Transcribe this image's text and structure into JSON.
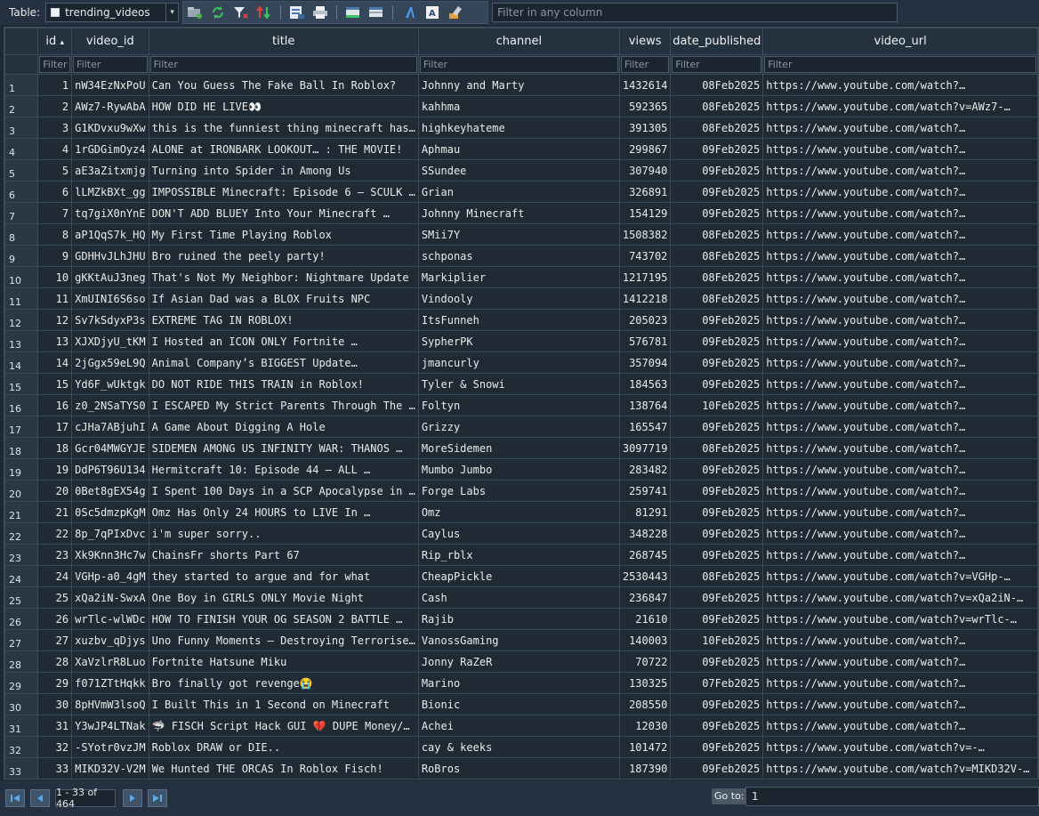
{
  "toolbar": {
    "table_label": "Table:",
    "table_name": "trending_videos",
    "filter_all_placeholder": "Filter in any column",
    "icons": [
      "open-tab-icon",
      "refresh-icon",
      "clear-filters-icon",
      "sort-icon",
      "save-table-icon",
      "print-icon",
      "add-record-icon",
      "delete-record-icon",
      "font-icon",
      "text-icon",
      "highlight-icon"
    ]
  },
  "columns": [
    {
      "key": "id",
      "label": "id",
      "sort": "▴"
    },
    {
      "key": "video_id",
      "label": "video_id"
    },
    {
      "key": "title",
      "label": "title"
    },
    {
      "key": "channel",
      "label": "channel"
    },
    {
      "key": "views",
      "label": "views"
    },
    {
      "key": "date_published",
      "label": "date_published"
    },
    {
      "key": "video_url",
      "label": "video_url"
    }
  ],
  "filter_placeholder": "Filter",
  "rows": [
    {
      "n": "1",
      "id": "1",
      "video_id": "nW34EzNxPoU",
      "title": "Can You Guess The Fake Ball In Roblox?",
      "channel": "Johnny and Marty",
      "views": "1432614",
      "date": "08Feb2025",
      "url": "https://www.youtube.com/watch?…"
    },
    {
      "n": "2",
      "id": "2",
      "video_id": "AWz7-RywAbA",
      "title": "HOW DID HE LIVE👀",
      "channel": "kahhma",
      "views": "592365",
      "date": "08Feb2025",
      "url": "https://www.youtube.com/watch?v=AWz7-…"
    },
    {
      "n": "3",
      "id": "3",
      "video_id": "G1KDvxu9wXw",
      "title": "this is the funniest thing minecraft has…",
      "channel": "highkeyhateme",
      "views": "391305",
      "date": "08Feb2025",
      "url": "https://www.youtube.com/watch?…"
    },
    {
      "n": "4",
      "id": "4",
      "video_id": "1rGDGimOyz4",
      "title": "ALONE at IRONBARK LOOKOUT… : THE MOVIE!",
      "channel": "Aphmau",
      "views": "299867",
      "date": "09Feb2025",
      "url": "https://www.youtube.com/watch?…"
    },
    {
      "n": "5",
      "id": "5",
      "video_id": "aE3aZitxmjg",
      "title": "Turning into Spider in Among Us",
      "channel": "SSundee",
      "views": "307940",
      "date": "09Feb2025",
      "url": "https://www.youtube.com/watch?…"
    },
    {
      "n": "6",
      "id": "6",
      "video_id": "lLMZkBXt_gg",
      "title": "IMPOSSIBLE Minecraft: Episode 6 – SCULK …",
      "channel": "Grian",
      "views": "326891",
      "date": "09Feb2025",
      "url": "https://www.youtube.com/watch?…"
    },
    {
      "n": "7",
      "id": "7",
      "video_id": "tq7giX0nYnE",
      "title": "DON'T ADD BLUEY Into Your Minecraft …",
      "channel": "Johnny Minecraft",
      "views": "154129",
      "date": "09Feb2025",
      "url": "https://www.youtube.com/watch?…"
    },
    {
      "n": "8",
      "id": "8",
      "video_id": "aP1QqS7k_HQ",
      "title": "My First Time Playing Roblox",
      "channel": "SMii7Y",
      "views": "1508382",
      "date": "08Feb2025",
      "url": "https://www.youtube.com/watch?…"
    },
    {
      "n": "9",
      "id": "9",
      "video_id": "GDHHvJLhJHU",
      "title": "Bro ruined the peely party!",
      "channel": "schponas",
      "views": "743702",
      "date": "08Feb2025",
      "url": "https://www.youtube.com/watch?…"
    },
    {
      "n": "10",
      "id": "10",
      "video_id": "gKKtAuJ3neg",
      "title": "That's Not My Neighbor: Nightmare Update",
      "channel": "Markiplier",
      "views": "1217195",
      "date": "08Feb2025",
      "url": "https://www.youtube.com/watch?…"
    },
    {
      "n": "11",
      "id": "11",
      "video_id": "XmUINI6S6so",
      "title": "If Asian Dad was a BLOX Fruits NPC",
      "channel": "Vindooly",
      "views": "1412218",
      "date": "08Feb2025",
      "url": "https://www.youtube.com/watch?…"
    },
    {
      "n": "12",
      "id": "12",
      "video_id": "Sv7kSdyxP3s",
      "title": "EXTREME TAG IN ROBLOX!",
      "channel": "ItsFunneh",
      "views": "205023",
      "date": "09Feb2025",
      "url": "https://www.youtube.com/watch?…"
    },
    {
      "n": "13",
      "id": "13",
      "video_id": "XJXDjyU_tKM",
      "title": "I Hosted an ICON ONLY Fortnite …",
      "channel": "SypherPK",
      "views": "576781",
      "date": "09Feb2025",
      "url": "https://www.youtube.com/watch?…"
    },
    {
      "n": "14",
      "id": "14",
      "video_id": "2jGgx59eL9Q",
      "title": "Animal Company’s BIGGEST Update…",
      "channel": "jmancurly",
      "views": "357094",
      "date": "09Feb2025",
      "url": "https://www.youtube.com/watch?…"
    },
    {
      "n": "15",
      "id": "15",
      "video_id": "Yd6F_wUktgk",
      "title": "DO NOT RIDE THIS TRAIN in Roblox!",
      "channel": "Tyler & Snowi",
      "views": "184563",
      "date": "09Feb2025",
      "url": "https://www.youtube.com/watch?…"
    },
    {
      "n": "16",
      "id": "16",
      "video_id": "z0_2NSaTYS0",
      "title": "I ESCAPED My Strict Parents Through The …",
      "channel": "Foltyn",
      "views": "138764",
      "date": "10Feb2025",
      "url": "https://www.youtube.com/watch?…"
    },
    {
      "n": "17",
      "id": "17",
      "video_id": "cJHa7ABjuhI",
      "title": "A Game About Digging A Hole",
      "channel": "Grizzy",
      "views": "165547",
      "date": "09Feb2025",
      "url": "https://www.youtube.com/watch?…"
    },
    {
      "n": "18",
      "id": "18",
      "video_id": "Gcr04MWGYJE",
      "title": "SIDEMEN AMONG US INFINITY WAR: THANOS …",
      "channel": "MoreSidemen",
      "views": "3097719",
      "date": "08Feb2025",
      "url": "https://www.youtube.com/watch?…"
    },
    {
      "n": "19",
      "id": "19",
      "video_id": "DdP6T96U134",
      "title": "Hermitcraft 10: Episode 44 – ALL …",
      "channel": "Mumbo Jumbo",
      "views": "283482",
      "date": "09Feb2025",
      "url": "https://www.youtube.com/watch?…"
    },
    {
      "n": "20",
      "id": "20",
      "video_id": "0Bet8gEX54g",
      "title": "I Spent 100 Days in a SCP Apocalypse in …",
      "channel": "Forge Labs",
      "views": "259741",
      "date": "09Feb2025",
      "url": "https://www.youtube.com/watch?…"
    },
    {
      "n": "21",
      "id": "21",
      "video_id": "0Sc5dmzpKgM",
      "title": "Omz Has Only 24 HOURS to LIVE In …",
      "channel": "Omz",
      "views": "81291",
      "date": "09Feb2025",
      "url": "https://www.youtube.com/watch?…"
    },
    {
      "n": "22",
      "id": "22",
      "video_id": "8p_7qPIxDvc",
      "title": "i'm super sorry..",
      "channel": "Caylus",
      "views": "348228",
      "date": "09Feb2025",
      "url": "https://www.youtube.com/watch?…"
    },
    {
      "n": "23",
      "id": "23",
      "video_id": "Xk9Knn3Hc7w",
      "title": "ChainsFr shorts Part 67",
      "channel": "Rip_rblx",
      "views": "268745",
      "date": "09Feb2025",
      "url": "https://www.youtube.com/watch?…"
    },
    {
      "n": "24",
      "id": "24",
      "video_id": "VGHp-a0_4gM",
      "title": "they started to argue and for what",
      "channel": "CheapPickle",
      "views": "2530443",
      "date": "08Feb2025",
      "url": "https://www.youtube.com/watch?v=VGHp-…"
    },
    {
      "n": "25",
      "id": "25",
      "video_id": "xQa2iN-SwxA",
      "title": "One Boy in GIRLS ONLY Movie Night",
      "channel": "Cash",
      "views": "236847",
      "date": "09Feb2025",
      "url": "https://www.youtube.com/watch?v=xQa2iN-…"
    },
    {
      "n": "26",
      "id": "26",
      "video_id": "wrTlc-wlWDc",
      "title": "HOW TO FINISH YOUR OG SEASON 2 BATTLE …",
      "channel": "Rajib",
      "views": "21610",
      "date": "09Feb2025",
      "url": "https://www.youtube.com/watch?v=wrTlc-…"
    },
    {
      "n": "27",
      "id": "27",
      "video_id": "xuzbv_qDjys",
      "title": "Uno Funny Moments – Destroying Terrorise…",
      "channel": "VanossGaming",
      "views": "140003",
      "date": "10Feb2025",
      "url": "https://www.youtube.com/watch?…"
    },
    {
      "n": "28",
      "id": "28",
      "video_id": "XaVzlrR8Luo",
      "title": "Fortnite Hatsune Miku",
      "channel": "Jonny RaZeR",
      "views": "70722",
      "date": "09Feb2025",
      "url": "https://www.youtube.com/watch?…"
    },
    {
      "n": "29",
      "id": "29",
      "video_id": "f071ZTtHqkk",
      "title": "Bro finally got revenge😭",
      "channel": "Marino",
      "views": "130325",
      "date": "07Feb2025",
      "url": "https://www.youtube.com/watch?…"
    },
    {
      "n": "30",
      "id": "30",
      "video_id": "8pHVmW3lsoQ",
      "title": "I Built This in 1 Second on Minecraft",
      "channel": "Bionic",
      "views": "208550",
      "date": "09Feb2025",
      "url": "https://www.youtube.com/watch?…"
    },
    {
      "n": "31",
      "id": "31",
      "video_id": "Y3wJP4LTNak",
      "title": "🦈 FISCH Script Hack GUI 💔 DUPE Money/…",
      "channel": "Achei",
      "views": "12030",
      "date": "09Feb2025",
      "url": "https://www.youtube.com/watch?…"
    },
    {
      "n": "32",
      "id": "32",
      "video_id": "-SYotr0vzJM",
      "title": "Roblox DRAW or DIE..",
      "channel": "cay & keeks",
      "views": "101472",
      "date": "09Feb2025",
      "url": "https://www.youtube.com/watch?v=-…"
    },
    {
      "n": "33",
      "id": "33",
      "video_id": "MIKD32V-V2M",
      "title": "We Hunted THE ORCAS In Roblox Fisch!",
      "channel": "RoBros",
      "views": "187390",
      "date": "09Feb2025",
      "url": "https://www.youtube.com/watch?v=MIKD32V-…"
    }
  ],
  "pager": {
    "info": "1 - 33 of 464",
    "goto_label": "Go to:",
    "goto_value": "1"
  }
}
